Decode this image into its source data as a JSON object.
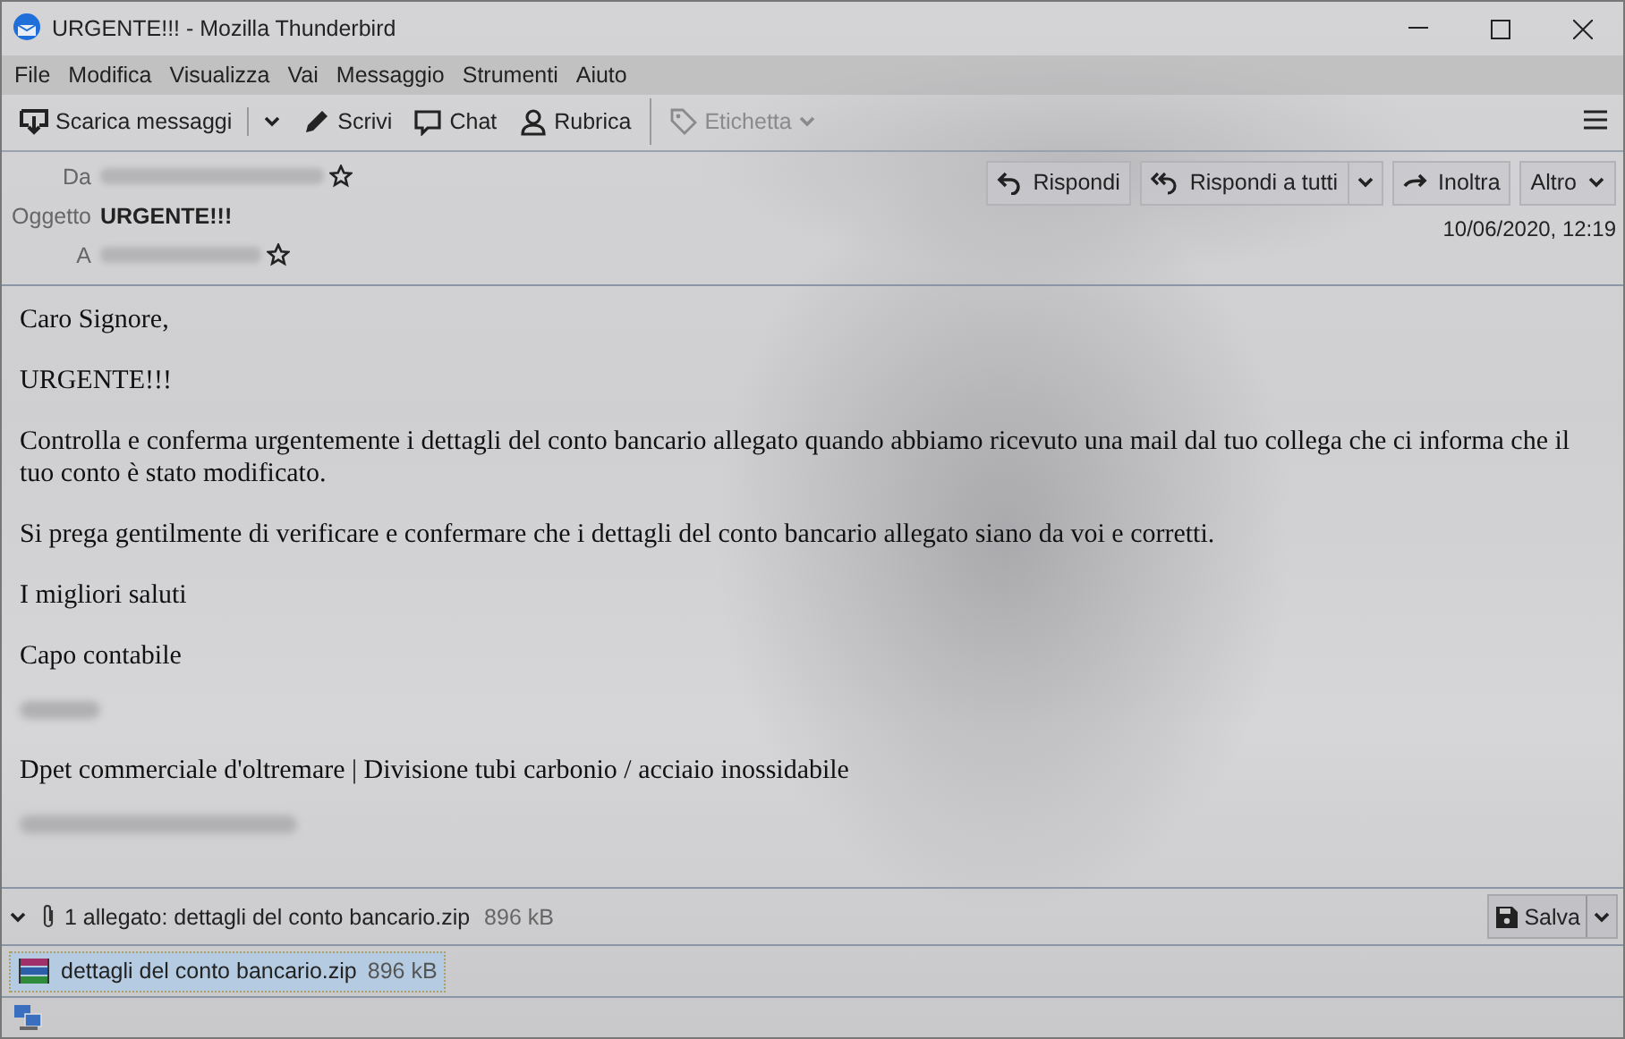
{
  "window": {
    "title": "URGENTE!!! - Mozilla Thunderbird"
  },
  "menu": [
    "File",
    "Modifica",
    "Visualizza",
    "Vai",
    "Messaggio",
    "Strumenti",
    "Aiuto"
  ],
  "toolbar": [
    {
      "kind": "split",
      "label": "Scarica messaggi",
      "disabled": false
    },
    {
      "kind": "button",
      "label": "Scrivi",
      "disabled": false
    },
    {
      "kind": "button",
      "label": "Chat",
      "disabled": false
    },
    {
      "kind": "button",
      "label": "Rubrica",
      "disabled": false
    },
    {
      "kind": "dropdown",
      "label": "Etichetta",
      "disabled": true
    }
  ],
  "header": {
    "fields": [
      {
        "kind": "address",
        "label": "Da"
      },
      {
        "kind": "subject",
        "label": "Oggetto",
        "value": "URGENTE!!!"
      },
      {
        "kind": "address",
        "label": "A"
      }
    ],
    "actions": [
      {
        "kind": "button",
        "label": "Rispondi"
      },
      {
        "kind": "split",
        "label": "Rispondi a tutti"
      },
      {
        "kind": "button",
        "label": "Inoltra"
      },
      {
        "kind": "dropdown",
        "label": "Altro"
      }
    ],
    "date": "10/06/2020, 12:19"
  },
  "body": [
    {
      "kind": "text",
      "text": "Caro Signore,"
    },
    {
      "kind": "text",
      "text": "URGENTE!!!"
    },
    {
      "kind": "text",
      "text": "Controlla e conferma urgentemente i dettagli del conto bancario allegato quando abbiamo ricevuto una mail dal tuo collega che ci informa che il tuo conto è stato modificato."
    },
    {
      "kind": "text",
      "text": "Si prega gentilmente di verificare e confermare che i dettagli del conto bancario allegato siano da voi e corretti."
    },
    {
      "kind": "text",
      "text": "I migliori saluti"
    },
    {
      "kind": "text",
      "text": "Capo contabile"
    },
    {
      "kind": "redacted"
    },
    {
      "kind": "text",
      "text": "Dpet commerciale d'oltremare | Divisione tubi carbonio / acciaio inossidabile"
    },
    {
      "kind": "redacted"
    }
  ],
  "attachments": {
    "expanded": true,
    "summary": "1 allegato: dettagli del conto bancario.zip",
    "size": "896 kB",
    "save": "Salva",
    "items": [
      {
        "name": "dettagli del conto bancario.zip",
        "size": "896 kB",
        "selected": true
      }
    ]
  }
}
